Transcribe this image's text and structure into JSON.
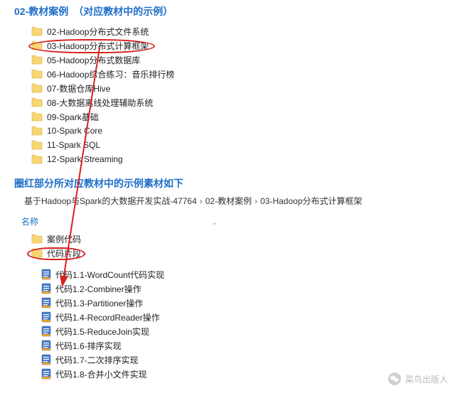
{
  "section1": {
    "title": "02-教材案例　（对应教材中的示例）",
    "folders": [
      "02-Hadoop分布式文件系统",
      "03-Hadoop分布式计算框架",
      "05-Hadoop分布式数据库",
      "06-Hadoop综合练习：音乐排行榜",
      "07-数据仓库Hive",
      "08-大数据离线处理辅助系统",
      "09-Spark基础",
      "10-Spark Core",
      "11-Spark SQL",
      "12-Spark Streaming"
    ]
  },
  "section2": {
    "title": "圈红部分所对应教材中的示例素材如下",
    "breadcrumb": [
      "基于Hadoop与Spark的大数据开发实战-47764",
      "02-教材案例",
      "03-Hadoop分布式计算框架"
    ],
    "name_header": "名称",
    "sub_folders": [
      "案例代码",
      "代码片段"
    ],
    "files": [
      "代码1.1-WordCount代码实现",
      "代码1.2-Combiner操作",
      "代码1.3-Partitioner操作",
      "代码1.4-RecordReader操作",
      "代码1.5-ReduceJoin实现",
      "代码1.6-排序实现",
      "代码1.7-二次排序实现",
      "代码1.8-合并小文件实现"
    ]
  },
  "footer": {
    "brand": "菜鸟出版人"
  }
}
